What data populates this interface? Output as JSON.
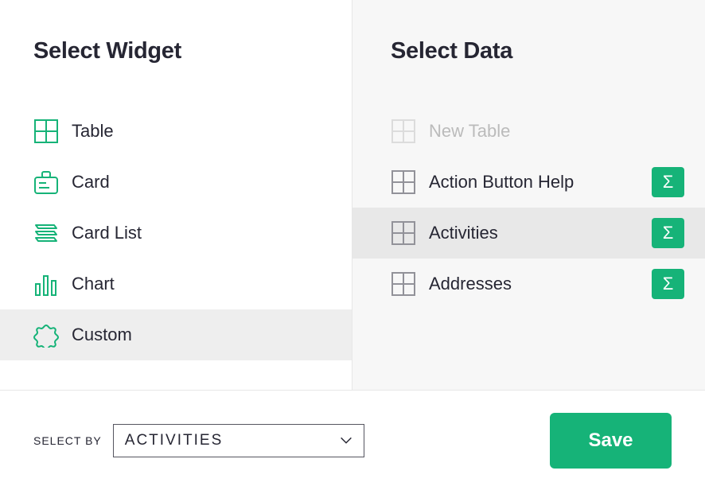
{
  "left": {
    "title": "Select Widget",
    "items": [
      {
        "icon": "table",
        "label": "Table",
        "selected": false
      },
      {
        "icon": "card",
        "label": "Card",
        "selected": false
      },
      {
        "icon": "cardlist",
        "label": "Card List",
        "selected": false
      },
      {
        "icon": "chart",
        "label": "Chart",
        "selected": false
      },
      {
        "icon": "custom",
        "label": "Custom",
        "selected": true
      }
    ]
  },
  "right": {
    "title": "Select Data",
    "items": [
      {
        "icon": "table",
        "label": "New Table",
        "state": "disabled"
      },
      {
        "icon": "table",
        "label": "Action Button Help",
        "state": "normal",
        "summary": true
      },
      {
        "icon": "table",
        "label": "Activities",
        "state": "selected",
        "summary": true
      },
      {
        "icon": "table",
        "label": "Addresses",
        "state": "normal",
        "summary": true
      }
    ]
  },
  "footer": {
    "select_by_label": "SELECT BY",
    "select_by_value": "ACTIVITIES",
    "save_label": "Save"
  }
}
